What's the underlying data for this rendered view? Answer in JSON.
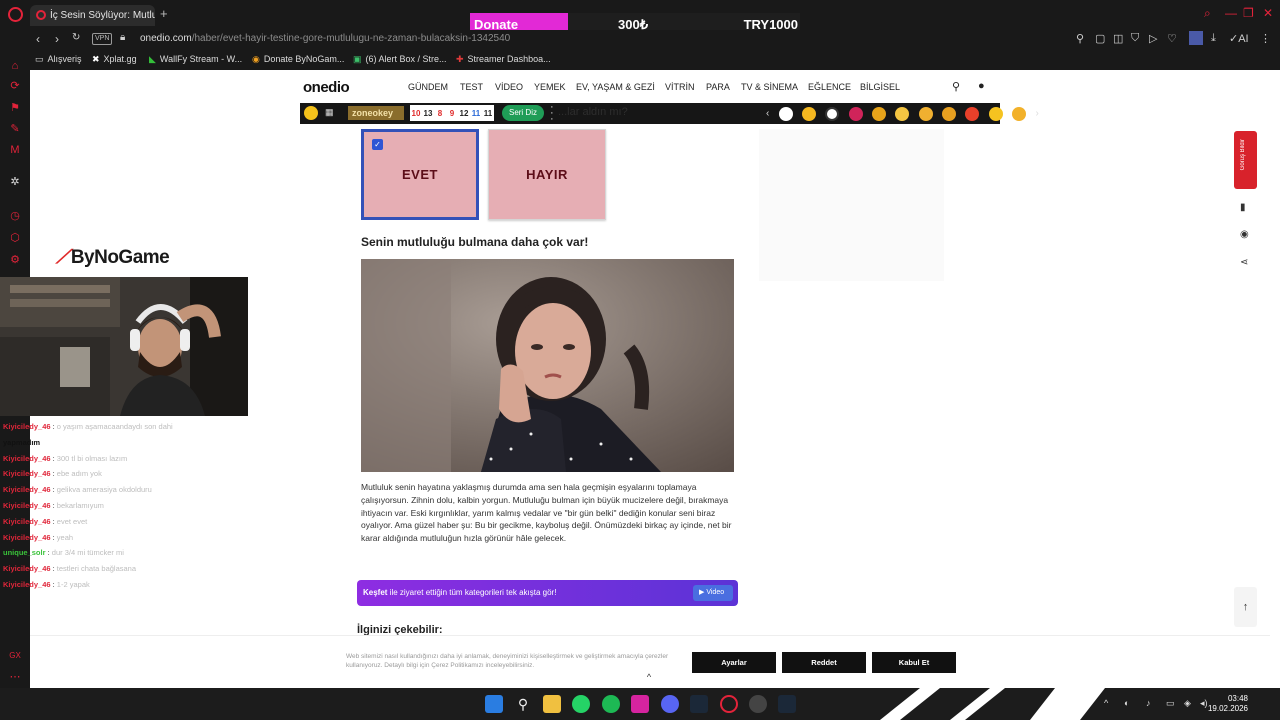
{
  "browser": {
    "tab_title": "İç Sesin Söylüyor: Mutluluğ",
    "new_tab_symbol": "+",
    "url_domain": "onedio.com",
    "url_path": "/haber/evet-hayir-testine-gore-mutlulugu-ne-zaman-bulacaksin-1342540",
    "vpn_label": "VPN",
    "bookmarks": [
      "Alışveriş",
      "Xplat.gg",
      "WallFy Stream - W...",
      "Donate ByNoGam...",
      "(6) Alert Box / Stre...",
      "Streamer Dashboa..."
    ]
  },
  "donate": {
    "label": "Donate",
    "amount": "300₺",
    "total": "TRY1000"
  },
  "site": {
    "logo": "onedio",
    "nav": [
      "GÜNDEM",
      "TEST",
      "VİDEO",
      "YEMEK",
      "EV, YAŞAM & GEZİ",
      "VİTRİN",
      "PARA",
      "TV & SİNEMA",
      "EĞLENCE",
      "BİLGİSEL"
    ],
    "subbar": {
      "zone_label": "zoneokey",
      "tiles": [
        "10",
        "13",
        "8",
        "9",
        "12",
        "11",
        "11"
      ],
      "serial_label": "Seri Diz",
      "faint_question": "...lar aldın mı?"
    }
  },
  "quiz": {
    "yes_label": "EVET",
    "no_label": "HAYIR",
    "result_title": "Senin mutluluğu bulmana daha çok var!",
    "result_text": "Mutluluk senin hayatına yaklaşmış durumda ama sen hala geçmişin eşyalarını toplamaya çalışıyorsun. Zihnin dolu, kalbin yorgun. Mutluluğu bulman için büyük mucizelere değil, bırakmaya ihtiyacın var. Eski kırgınlıklar, yarım kalmış vedalar ve \"bir gün belki\" dediğin konular seni biraz oyalıyor. Ama güzel haber şu: Bu bir gecikme, kayboluş değil. Önümüzdeki birkaç ay içinde, net bir karar aldığında mutluluğun hızla görünür hâle gelecek.",
    "kesfet_bold": "Keşfet",
    "kesfet_text": " ile ziyaret ettiğin tüm kategorileri tek akışta gör!",
    "kesfet_button": "Video",
    "ilginizi": "İlginizi çekebilir:"
  },
  "sidebar": {
    "red_label": "Görüş Bildir"
  },
  "stream": {
    "brand": "ByNoGame",
    "chat": [
      {
        "user": "Kiyiciledy_46",
        "msg": "o yaşım aşamacaandaydı son dahi",
        "color": "red"
      },
      {
        "user": "yapmadım",
        "msg": "",
        "color": "black"
      },
      {
        "user": "Kiyiciledy_46",
        "msg": "300 tl bi olması lazım",
        "color": "red"
      },
      {
        "user": "Kiyiciledy_46",
        "msg": "ebe adım yok",
        "color": "red"
      },
      {
        "user": "Kiyiciledy_46",
        "msg": "gelikva amerasiya okdolduru",
        "color": "red"
      },
      {
        "user": "Kiyiciledy_46",
        "msg": "bekarlamıyum",
        "color": "red"
      },
      {
        "user": "Kiyiciledy_46",
        "msg": "evet evet",
        "color": "red"
      },
      {
        "user": "Kiyiciledy_46",
        "msg": "yeah",
        "color": "red"
      },
      {
        "user": "unique_solr",
        "msg": "dur 3/4 mi tümcker mi",
        "color": "green"
      },
      {
        "user": "Kiyiciledy_46",
        "msg": "testleri chata bağlasana",
        "color": "red"
      },
      {
        "user": "Kiyiciledy_46",
        "msg": "1-2 yapak",
        "color": "red"
      }
    ]
  },
  "cookie": {
    "text": "Web sitemizi nasıl kullandığınızı daha iyi anlamak, deneyiminizi kişiselleştirmek ve geliştirmek amacıyla çerezler kullanıyoruz. Detaylı bilgi için Çerez Politikamızı inceleyebilirsiniz.",
    "settings": "Ayarlar",
    "reject": "Reddet",
    "accept": "Kabul Et",
    "chevron": "^"
  },
  "taskbar": {
    "time": "03:48",
    "date": "19.02.2026"
  },
  "colors": {
    "onedio_accent": "#e3233a",
    "choice_bg": "#e6aeb4",
    "choice_text": "#5c0d18",
    "selected_border": "#3351b8",
    "donate_pink": "#e229d6",
    "kesfet_purple": "#8e2de2"
  }
}
